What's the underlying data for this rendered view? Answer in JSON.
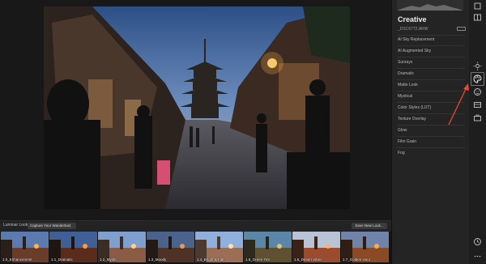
{
  "panel": {
    "title": "Creative",
    "file_name": "_DSC6772.ARW",
    "tools": [
      {
        "label": "AI Sky Replacement"
      },
      {
        "label": "AI Augmented Sky"
      },
      {
        "label": "Sunrays"
      },
      {
        "label": "Dramatic"
      },
      {
        "label": "Matte Look"
      },
      {
        "label": "Mystical"
      },
      {
        "label": "Color Styles (LUT)"
      },
      {
        "label": "Texture Overlay"
      },
      {
        "label": "Glow"
      },
      {
        "label": "Film Grain"
      },
      {
        "label": "Fog"
      }
    ]
  },
  "looks_bar": {
    "label": "Luminar Looks:",
    "selected_collection": "Capture Your Wanderlust",
    "save_button": "Save New Look..."
  },
  "looks": [
    {
      "label": "1.0_Enhancement"
    },
    {
      "label": "1.1_Dramatic"
    },
    {
      "label": "1.2_Mystic"
    },
    {
      "label": "1.3_Moody"
    },
    {
      "label": "1.4_Bright & Flat"
    },
    {
      "label": "1.5_Green Tint"
    },
    {
      "label": "1.6_Desert Vibes"
    },
    {
      "label": "1.7_Golden Hour"
    }
  ],
  "toolbar_icons": [
    "sun-icon",
    "palette-icon",
    "face-icon",
    "layers-icon",
    "briefcase-icon",
    "clock-icon",
    "more-icon"
  ],
  "colors": {
    "highlight": "#e84a2b",
    "panel_bg": "#242424"
  }
}
